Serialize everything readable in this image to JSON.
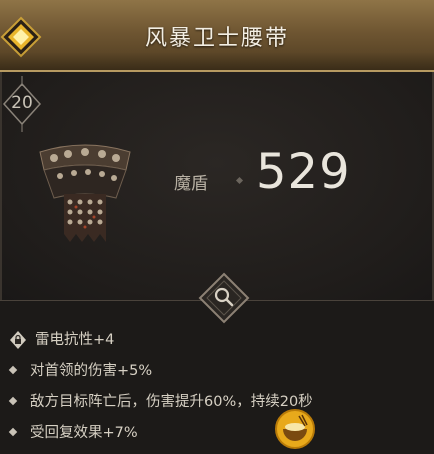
{
  "item": {
    "name": "风暴卫士腰带",
    "level": "20",
    "stat_label": "魔盾",
    "stat_value": "529"
  },
  "affixes": [
    {
      "text": "雷电抗性+4",
      "icon": "lock-icon"
    },
    {
      "text": "对首领的伤害+5%",
      "icon": "diamond-bullet-icon"
    },
    {
      "text": "敌方目标阵亡后，伤害提升60%，持续20秒",
      "icon": "diamond-bullet-icon"
    },
    {
      "text": "受回复效果+7%",
      "icon": "diamond-bullet-icon"
    }
  ],
  "icons": {
    "corner": "gold-diamond-icon",
    "emblem": "magnifier-icon",
    "watermark": "food-bowl-logo"
  },
  "colors": {
    "header": "#6f5632",
    "gold": "#f0c23a",
    "panel": "#201d1b"
  }
}
